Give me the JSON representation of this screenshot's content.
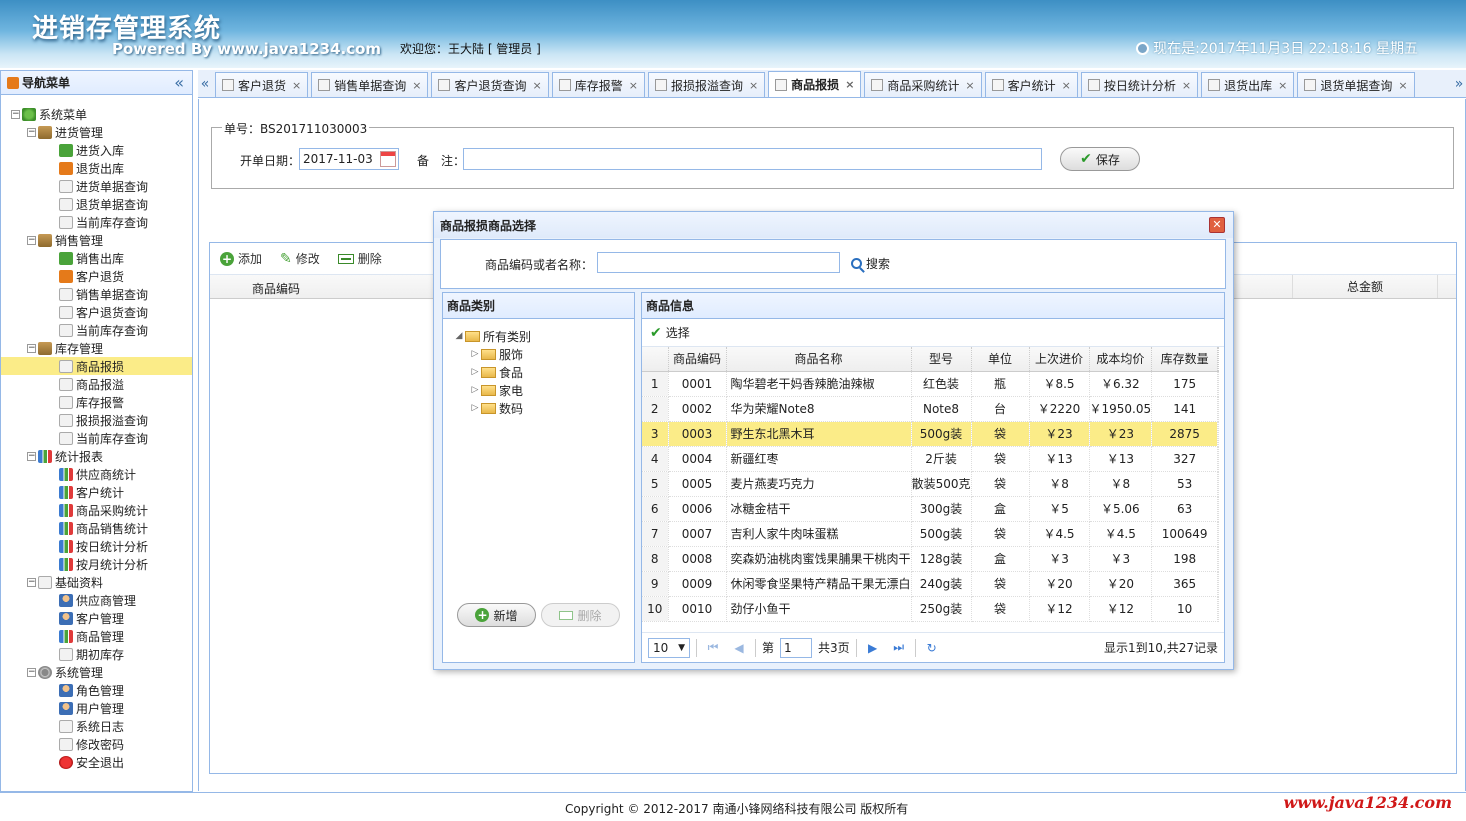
{
  "header": {
    "title": "进销存管理系统",
    "powered": "Powered By www.java1234.com",
    "welcome": "欢迎您：王大陆 [ 管理员 ]",
    "clock": "现在是:2017年11月3日 22:18:16 星期五"
  },
  "nav": {
    "title": "导航菜单",
    "items": [
      {
        "label": "系统菜单",
        "level": 0,
        "expander": "⊟",
        "icon": "root-icon"
      },
      {
        "label": "进货管理",
        "level": 1,
        "expander": "⊟",
        "icon": "folder-icon"
      },
      {
        "label": "进货入库",
        "level": 2,
        "icon": "arrow-in-icon"
      },
      {
        "label": "退货出库",
        "level": 2,
        "icon": "arrow-out-icon"
      },
      {
        "label": "进货单据查询",
        "level": 2,
        "icon": "page-icon"
      },
      {
        "label": "退货单据查询",
        "level": 2,
        "icon": "page-icon"
      },
      {
        "label": "当前库存查询",
        "level": 2,
        "icon": "page-icon"
      },
      {
        "label": "销售管理",
        "level": 1,
        "expander": "⊟",
        "icon": "folder-icon"
      },
      {
        "label": "销售出库",
        "level": 2,
        "icon": "arrow-in-icon"
      },
      {
        "label": "客户退货",
        "level": 2,
        "icon": "arrow-out-icon"
      },
      {
        "label": "销售单据查询",
        "level": 2,
        "icon": "page-icon"
      },
      {
        "label": "客户退货查询",
        "level": 2,
        "icon": "page-icon"
      },
      {
        "label": "当前库存查询",
        "level": 2,
        "icon": "page-icon"
      },
      {
        "label": "库存管理",
        "level": 1,
        "expander": "⊟",
        "icon": "folder-icon"
      },
      {
        "label": "商品报损",
        "level": 2,
        "icon": "page-icon",
        "selected": true
      },
      {
        "label": "商品报溢",
        "level": 2,
        "icon": "page-icon"
      },
      {
        "label": "库存报警",
        "level": 2,
        "icon": "page-icon"
      },
      {
        "label": "报损报溢查询",
        "level": 2,
        "icon": "page-icon"
      },
      {
        "label": "当前库存查询",
        "level": 2,
        "icon": "page-icon"
      },
      {
        "label": "统计报表",
        "level": 1,
        "expander": "⊟",
        "icon": "chart-icon"
      },
      {
        "label": "供应商统计",
        "level": 2,
        "icon": "chart-icon"
      },
      {
        "label": "客户统计",
        "level": 2,
        "icon": "chart-icon"
      },
      {
        "label": "商品采购统计",
        "level": 2,
        "icon": "chart-icon"
      },
      {
        "label": "商品销售统计",
        "level": 2,
        "icon": "chart-icon"
      },
      {
        "label": "按日统计分析",
        "level": 2,
        "icon": "chart-icon"
      },
      {
        "label": "按月统计分析",
        "level": 2,
        "icon": "chart-icon"
      },
      {
        "label": "基础资料",
        "level": 1,
        "expander": "⊟",
        "icon": "page-icon"
      },
      {
        "label": "供应商管理",
        "level": 2,
        "icon": "user-icon"
      },
      {
        "label": "客户管理",
        "level": 2,
        "icon": "user-icon"
      },
      {
        "label": "商品管理",
        "level": 2,
        "icon": "chart-icon"
      },
      {
        "label": "期初库存",
        "level": 2,
        "icon": "page-icon"
      },
      {
        "label": "系统管理",
        "level": 1,
        "expander": "⊟",
        "icon": "gear-icon"
      },
      {
        "label": "角色管理",
        "level": 2,
        "icon": "user-icon"
      },
      {
        "label": "用户管理",
        "level": 2,
        "icon": "user-icon"
      },
      {
        "label": "系统日志",
        "level": 2,
        "icon": "page-icon"
      },
      {
        "label": "修改密码",
        "level": 2,
        "icon": "page-icon"
      },
      {
        "label": "安全退出",
        "level": 2,
        "icon": "exit-icon"
      }
    ]
  },
  "tabs": [
    {
      "label": "客户退货"
    },
    {
      "label": "销售单据查询"
    },
    {
      "label": "客户退货查询"
    },
    {
      "label": "库存报警"
    },
    {
      "label": "报损报溢查询"
    },
    {
      "label": "商品报损",
      "active": true
    },
    {
      "label": "商品采购统计"
    },
    {
      "label": "客户统计"
    },
    {
      "label": "按日统计分析"
    },
    {
      "label": "退货出库"
    },
    {
      "label": "退货单据查询"
    }
  ],
  "form": {
    "order_no": "单号：BS201711030003",
    "date_label": "开单日期：",
    "date_value": "2017-11-03",
    "remark_label": "备　注：",
    "save_label": "保存"
  },
  "grid": {
    "add": "添加",
    "edit": "修改",
    "delete": "删除",
    "col_code": "商品编码",
    "col_total": "总金额"
  },
  "dialog": {
    "title": "商品报损商品选择",
    "search_label": "商品编码或者名称：",
    "search_value": "",
    "search_button": "搜索",
    "category_title": "商品类别",
    "categories": [
      {
        "label": "所有类别",
        "root": true
      },
      {
        "label": "服饰"
      },
      {
        "label": "食品"
      },
      {
        "label": "家电"
      },
      {
        "label": "数码"
      }
    ],
    "new_button": "新增",
    "delete_button": "删除",
    "info_title": "商品信息",
    "select_button": "选择",
    "columns": [
      "商品编码",
      "商品名称",
      "型号",
      "单位",
      "上次进价",
      "成本均价",
      "库存数量"
    ],
    "rows": [
      {
        "n": "1",
        "code": "0001",
        "name": "陶华碧老干妈香辣脆油辣椒",
        "model": "红色装",
        "unit": "瓶",
        "last": "￥8.5",
        "avg": "￥6.32",
        "qty": "175"
      },
      {
        "n": "2",
        "code": "0002",
        "name": "华为荣耀Note8",
        "model": "Note8",
        "unit": "台",
        "last": "￥2220",
        "avg": "￥1950.05",
        "qty": "141"
      },
      {
        "n": "3",
        "code": "0003",
        "name": "野生东北黑木耳",
        "model": "500g装",
        "unit": "袋",
        "last": "￥23",
        "avg": "￥23",
        "qty": "2875",
        "selected": true
      },
      {
        "n": "4",
        "code": "0004",
        "name": "新疆红枣",
        "model": "2斤装",
        "unit": "袋",
        "last": "￥13",
        "avg": "￥13",
        "qty": "327"
      },
      {
        "n": "5",
        "code": "0005",
        "name": "麦片燕麦巧克力",
        "model": "散装500克",
        "unit": "袋",
        "last": "￥8",
        "avg": "￥8",
        "qty": "53"
      },
      {
        "n": "6",
        "code": "0006",
        "name": "冰糖金桔干",
        "model": "300g装",
        "unit": "盒",
        "last": "￥5",
        "avg": "￥5.06",
        "qty": "63"
      },
      {
        "n": "7",
        "code": "0007",
        "name": "吉利人家牛肉味蛋糕",
        "model": "500g装",
        "unit": "袋",
        "last": "￥4.5",
        "avg": "￥4.5",
        "qty": "100649"
      },
      {
        "n": "8",
        "code": "0008",
        "name": "奕森奶油桃肉蜜饯果脯果干桃肉干",
        "model": "128g装",
        "unit": "盒",
        "last": "￥3",
        "avg": "￥3",
        "qty": "198"
      },
      {
        "n": "9",
        "code": "0009",
        "name": "休闲零食坚果特产精品干果无漂白",
        "model": "240g装",
        "unit": "袋",
        "last": "￥20",
        "avg": "￥20",
        "qty": "365"
      },
      {
        "n": "10",
        "code": "0010",
        "name": "劲仔小鱼干",
        "model": "250g装",
        "unit": "袋",
        "last": "￥12",
        "avg": "￥12",
        "qty": "10"
      }
    ],
    "pager": {
      "page_size": "10",
      "page_prefix": "第",
      "page_value": "1",
      "page_suffix": "共3页",
      "info": "显示1到10,共27记录"
    }
  },
  "footer": {
    "copyright": "Copyright © 2012-2017 南通小锋网络科技有限公司 版权所有",
    "watermark": "www.java1234.com"
  }
}
